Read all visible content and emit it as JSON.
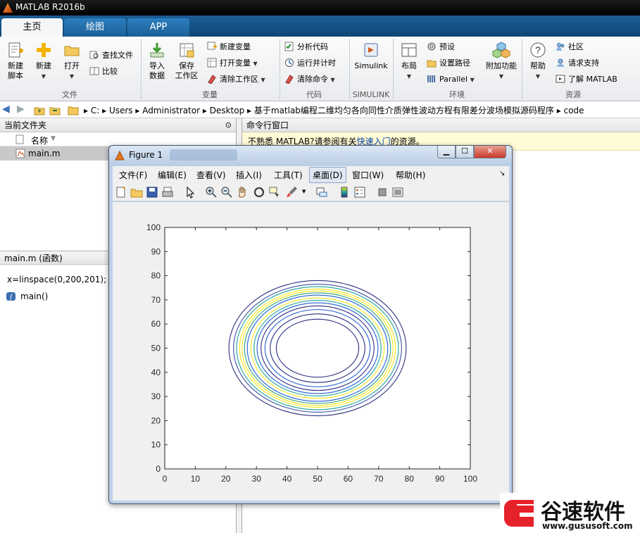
{
  "app": {
    "title": "MATLAB R2016b"
  },
  "tabs": [
    {
      "label": "主页"
    },
    {
      "label": "绘图"
    },
    {
      "label": "APP"
    }
  ],
  "ribbon": {
    "new_script": "新建\n脚本",
    "new_script_l1": "新建",
    "new_script_l2": "脚本",
    "new": "新建",
    "open": "打开",
    "find_files": "查找文件",
    "compare": "比较",
    "import_l1": "导入",
    "import_l2": "数据",
    "save_l1": "保存",
    "save_l2": "工作区",
    "new_variable": "新建变量",
    "open_variable": "打开变量",
    "clear_workspace": "清除工作区",
    "analyze_code": "分析代码",
    "run_and_time": "运行并计时",
    "clear_commands": "清除命令",
    "simulink": "Simulink",
    "layout": "布局",
    "preferences": "预设",
    "set_path": "设置路径",
    "parallel": "Parallel",
    "addons": "附加功能",
    "help": "帮助",
    "community": "社区",
    "request_support": "请求支持",
    "learn_matlab": "了解 MATLAB",
    "groups": [
      "文件",
      "变量",
      "代码",
      "SIMULINK",
      "环境",
      "资源"
    ]
  },
  "address": {
    "segments": [
      "C:",
      "Users",
      "Administrator",
      "Desktop",
      "基于matlab编程二维均匀各向同性介质弹性波动方程有限差分波场模拟源码程序",
      "code"
    ]
  },
  "current_folder": {
    "title": "当前文件夹",
    "column": "名称",
    "files": [
      "main.m"
    ]
  },
  "details": {
    "title": "main.m  (函数)",
    "code_line": "x=linspace(0,200,201);",
    "function_item": "main()"
  },
  "command_window": {
    "title": "命令行窗口",
    "notice_prefix": "不熟悉 MATLAB?请参阅有关",
    "notice_link": "快速入门",
    "notice_suffix": "的资源。"
  },
  "figure": {
    "title": "Figure 1",
    "menu": [
      "文件(F)",
      "编辑(E)",
      "查看(V)",
      "插入(I)",
      "工具(T)",
      "桌面(D)",
      "窗口(W)",
      "帮助(H)"
    ],
    "toolbar_icons": [
      "new-figure-icon",
      "open-file-icon",
      "save-icon",
      "print-icon",
      "select-arrow-icon",
      "zoom-in-icon",
      "zoom-out-icon",
      "pan-hand-icon",
      "rotate-3d-icon",
      "data-cursor-icon",
      "brush-icon",
      "link-plot-icon",
      "colorbar-icon",
      "legend-icon",
      "hide-plot-tools-icon",
      "show-plot-tools-icon"
    ]
  },
  "watermark": {
    "brand": "谷速软件",
    "url": "www.gususoft.com"
  },
  "colors": {
    "matlab_blue": "#0e4775",
    "contour_dark": "#2c2f7e",
    "contour_blue": "#1f5fd0",
    "contour_teal": "#1aa39a",
    "contour_yellow": "#f4e51a"
  },
  "chart_data": {
    "type": "contour",
    "title": "",
    "xlabel": "",
    "ylabel": "",
    "xlim": [
      0,
      100
    ],
    "ylim": [
      0,
      100
    ],
    "xticks": [
      0,
      10,
      20,
      30,
      40,
      50,
      60,
      70,
      80,
      90,
      100
    ],
    "yticks": [
      0,
      10,
      20,
      30,
      40,
      50,
      60,
      70,
      80,
      90,
      100
    ],
    "center": [
      50,
      50
    ],
    "contours": [
      {
        "rx": 29,
        "ry": 28,
        "color": "#2c2f7e"
      },
      {
        "rx": 27.5,
        "ry": 26.5,
        "color": "#3a4fa8"
      },
      {
        "rx": 26.5,
        "ry": 25.5,
        "color": "#1aa39a"
      },
      {
        "rx": 25.5,
        "ry": 24.5,
        "color": "#f4e51a"
      },
      {
        "rx": 24.7,
        "ry": 23.7,
        "color": "#f4e51a"
      },
      {
        "rx": 23.9,
        "ry": 22.9,
        "color": "#2aa07f"
      },
      {
        "rx": 23.0,
        "ry": 22.0,
        "color": "#1f5fd0"
      },
      {
        "rx": 21.8,
        "ry": 20.8,
        "color": "#f4e51a"
      },
      {
        "rx": 20.8,
        "ry": 19.8,
        "color": "#1aa39a"
      },
      {
        "rx": 19.8,
        "ry": 18.8,
        "color": "#1f5fd0"
      },
      {
        "rx": 18.5,
        "ry": 17.5,
        "color": "#2c2f7e"
      },
      {
        "rx": 17.2,
        "ry": 16.0,
        "color": "#1f5fd0"
      },
      {
        "rx": 15.5,
        "ry": 14.2,
        "color": "#2c2f7e"
      },
      {
        "rx": 13.5,
        "ry": 12.0,
        "color": "#2c2f7e"
      }
    ]
  }
}
